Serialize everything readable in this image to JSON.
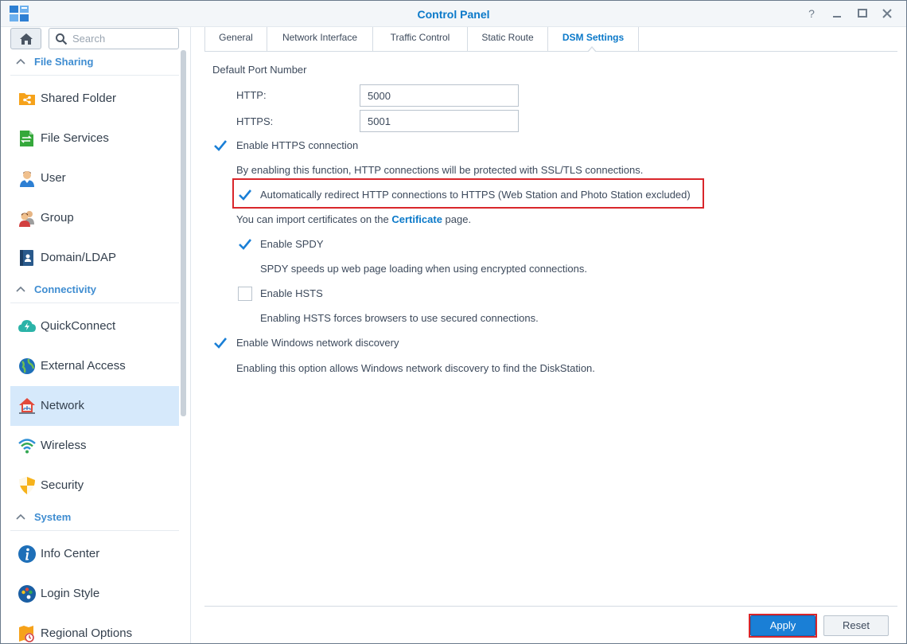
{
  "window": {
    "title": "Control Panel"
  },
  "search": {
    "placeholder": "Search"
  },
  "sidebar": {
    "sections": [
      {
        "label": "File Sharing",
        "items": [
          {
            "label": "Shared Folder",
            "icon": "shared-folder-icon"
          },
          {
            "label": "File Services",
            "icon": "file-services-icon"
          },
          {
            "label": "User",
            "icon": "user-icon"
          },
          {
            "label": "Group",
            "icon": "group-icon"
          },
          {
            "label": "Domain/LDAP",
            "icon": "domain-ldap-icon"
          }
        ]
      },
      {
        "label": "Connectivity",
        "items": [
          {
            "label": "QuickConnect",
            "icon": "quickconnect-icon"
          },
          {
            "label": "External Access",
            "icon": "external-access-icon"
          },
          {
            "label": "Network",
            "icon": "network-icon",
            "active": true
          },
          {
            "label": "Wireless",
            "icon": "wireless-icon"
          },
          {
            "label": "Security",
            "icon": "security-icon"
          }
        ]
      },
      {
        "label": "System",
        "items": [
          {
            "label": "Info Center",
            "icon": "info-center-icon"
          },
          {
            "label": "Login Style",
            "icon": "login-style-icon"
          },
          {
            "label": "Regional Options",
            "icon": "regional-options-icon"
          }
        ]
      }
    ]
  },
  "tabs": [
    {
      "label": "General"
    },
    {
      "label": "Network Interface"
    },
    {
      "label": "Traffic Control"
    },
    {
      "label": "Static Route"
    },
    {
      "label": "DSM Settings",
      "active": true
    }
  ],
  "settings": {
    "default_port_label": "Default Port Number",
    "http_label": "HTTP:",
    "http_value": "5000",
    "https_label": "HTTPS:",
    "https_value": "5001",
    "enable_https": {
      "label": "Enable HTTPS connection",
      "checked": true
    },
    "https_desc": "By enabling this function, HTTP connections will be protected with SSL/TLS connections.",
    "auto_redirect": {
      "label": "Automatically redirect HTTP connections to HTTPS (Web Station and Photo Station excluded)",
      "checked": true
    },
    "cert_text_pre": "You can import certificates on the ",
    "cert_link": "Certificate",
    "cert_text_post": " page.",
    "enable_spdy": {
      "label": "Enable SPDY",
      "checked": true
    },
    "spdy_desc": "SPDY speeds up web page loading when using encrypted connections.",
    "enable_hsts": {
      "label": "Enable HSTS",
      "checked": false
    },
    "hsts_desc": "Enabling HSTS forces browsers to use secured connections.",
    "enable_win_discovery": {
      "label": "Enable Windows network discovery",
      "checked": true
    },
    "win_discovery_desc": "Enabling this option allows Windows network discovery to find the DiskStation."
  },
  "footer": {
    "apply_label": "Apply",
    "reset_label": "Reset"
  },
  "colors": {
    "accent": "#0b79c9",
    "highlight_red": "#d9262b",
    "active_nav_bg": "#d6e9fb",
    "apply_bg": "#1a7fd6"
  }
}
